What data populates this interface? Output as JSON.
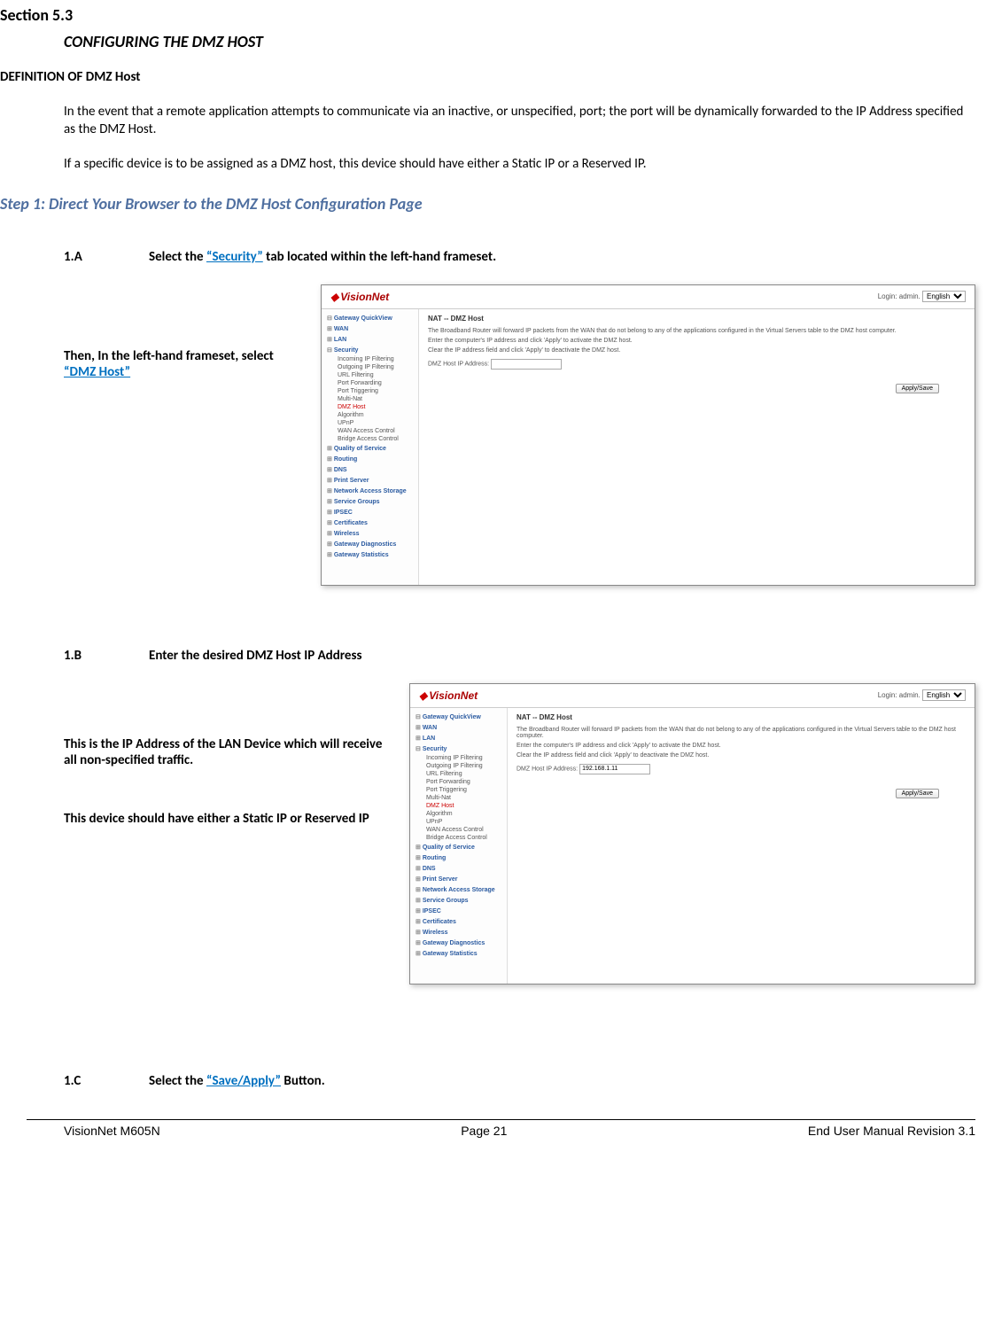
{
  "section": {
    "number": "Section 5.3",
    "title": "CONFIGURING THE DMZ HOST"
  },
  "definition": {
    "heading": "DEFINITION OF DMZ Host",
    "para1": "In the event that a remote application attempts to communicate via an inactive, or unspecified, port; the port will be dynamically forwarded to the IP Address specified as the DMZ Host.",
    "para2": "If a specific device is to be assigned as a DMZ host, this device should have either a Static IP or a Reserved IP."
  },
  "step1": {
    "heading": "Step 1: Direct Your Browser to the DMZ Host Configuration Page"
  },
  "step_1a": {
    "label": "1.A",
    "text_before": "Select the ",
    "link": "“Security”",
    "text_after": " tab located within the left-hand frameset.",
    "side_before": "Then, In the left-hand frameset, select ",
    "side_link": "“DMZ Host”"
  },
  "step_1b": {
    "label": "1.B",
    "text": "Enter the desired DMZ Host IP Address",
    "side_p1": "This is the IP Address of the LAN Device which will receive all non-specified traffic.",
    "side_p2": "This device should have either a Static IP or Reserved IP"
  },
  "step_1c": {
    "label": "1.C",
    "text_before": "Select the ",
    "link": "“Save/Apply”",
    "text_after": " Button."
  },
  "mock": {
    "logo": "VisionNet",
    "login_label": "Login: admin.",
    "lang_selected": "English",
    "sidebar": {
      "quickview": "Gateway QuickView",
      "wan": "WAN",
      "lan": "LAN",
      "security": "Security",
      "security_items": [
        "Incoming IP Filtering",
        "Outgoing IP Filtering",
        "URL Filtering",
        "Port Forwarding",
        "Port Triggering",
        "Multi-Nat",
        "DMZ Host",
        "Algorithm",
        "UPnP",
        "WAN Access Control",
        "Bridge Access Control"
      ],
      "rest": [
        "Quality of Service",
        "Routing",
        "DNS",
        "Print Server",
        "Network Access Storage",
        "Service Groups",
        "IPSEC",
        "Certificates",
        "Wireless",
        "Gateway Diagnostics",
        "Gateway Statistics"
      ]
    },
    "main": {
      "title": "NAT -- DMZ Host",
      "desc": "The Broadband Router will forward IP packets from the WAN that do not belong to any of the applications configured in the Virtual Servers table to the DMZ host computer.",
      "instr1": "Enter the computer's IP address and click 'Apply' to activate the DMZ host.",
      "instr2": "Clear the IP address field and click 'Apply' to deactivate the DMZ host.",
      "field_label": "DMZ Host IP Address:",
      "field_value_empty": "",
      "field_value_filled": "192.168.1.11",
      "apply_btn": "Apply/Save"
    }
  },
  "footer": {
    "left": "VisionNet M605N",
    "center": "Page 21",
    "right": "End User Manual Revision 3.1"
  }
}
